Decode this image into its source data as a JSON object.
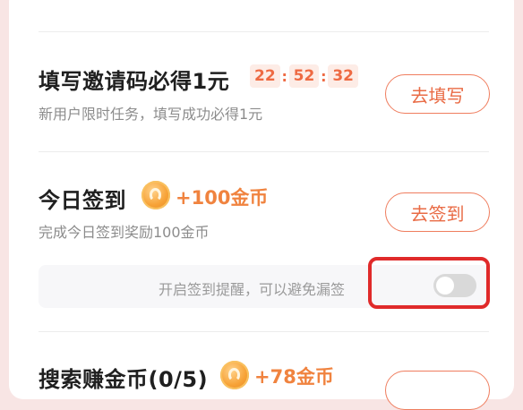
{
  "tasks": {
    "invite": {
      "title": "填写邀请码必得1元",
      "subtitle": "新用户限时任务，填写成功必得1元",
      "timer": {
        "h": "22",
        "m": "52",
        "s": "32",
        "sep": ":"
      },
      "button": "去填写"
    },
    "checkin": {
      "title": "今日签到",
      "reward": "+100金币",
      "subtitle": "完成今日签到奖励100金币",
      "button": "去签到",
      "reminder_text": "开启签到提醒，可以避免漏签",
      "reminder_enabled": false
    },
    "search": {
      "title": "搜索赚金币(0/5)",
      "reward": "+78金币"
    }
  },
  "colors": {
    "accent": "#ef7d5e",
    "reward": "#f0833f",
    "highlight": "#e02a2a"
  },
  "icons": {
    "coin": "coin-icon"
  }
}
